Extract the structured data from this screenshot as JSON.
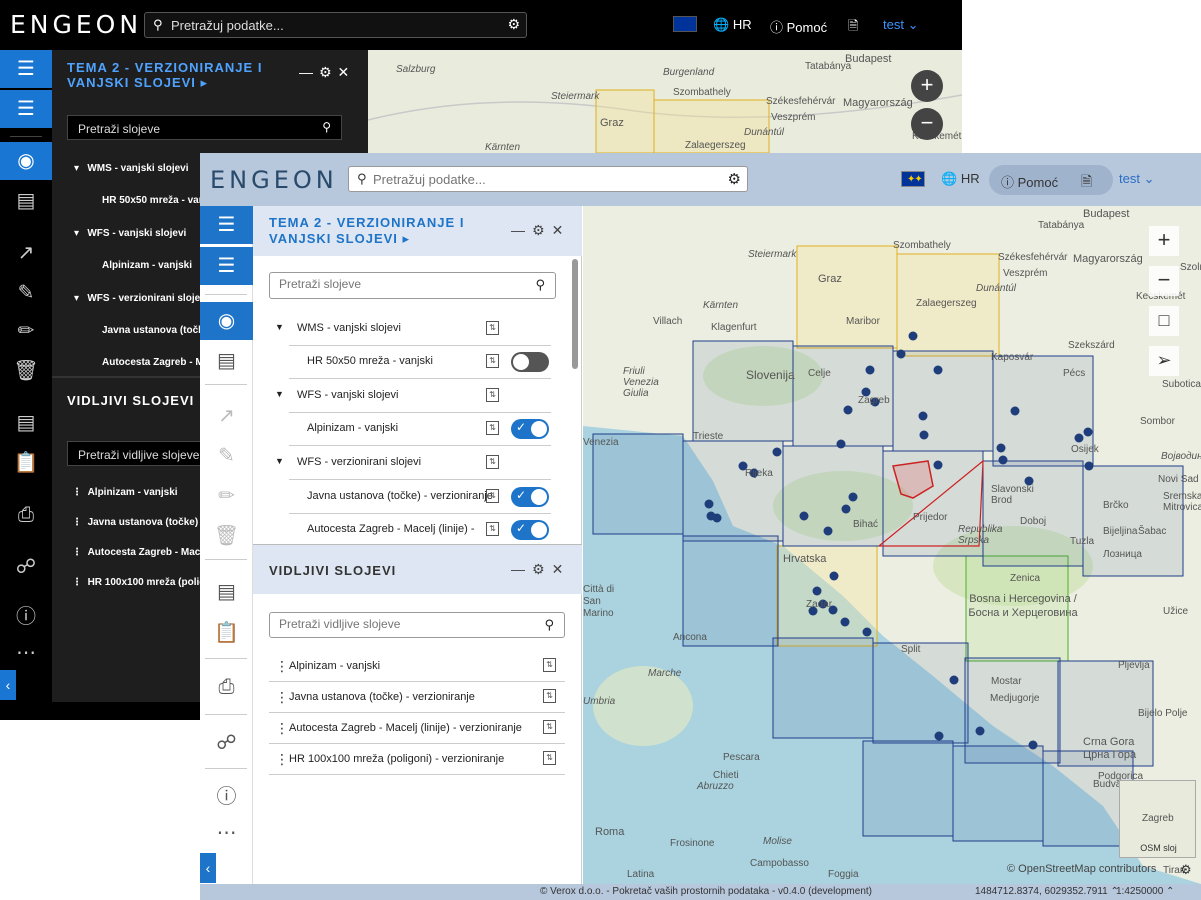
{
  "dark": {
    "logo": "ENGEON",
    "search_placeholder": "Pretražuj podatke...",
    "lang": "HR",
    "help": "Pomoć",
    "user": "test",
    "panel_title": "TEMA 2 - VERZIONIRANJE I VANJSKI SLOJEVI",
    "layer_search_placeholder": "Pretraži slojeve",
    "tree": [
      {
        "label": "WMS - vanjski slojevi",
        "group": true
      },
      {
        "label": "HR 50x50 mreža - vanjski",
        "group": false
      },
      {
        "label": "WFS - vanjski slojevi",
        "group": true
      },
      {
        "label": "Alpinizam - vanjski",
        "group": false
      },
      {
        "label": "WFS - verzionirani slojevi",
        "group": true
      },
      {
        "label": "Javna ustanova (točke)",
        "group": false
      },
      {
        "label": "Autocesta Zagreb - Mac",
        "group": false
      }
    ],
    "visible_title": "VIDLJIVI SLOJEVI",
    "visible_search_placeholder": "Pretraži vidljive slojeve",
    "visible": [
      "Alpinizam - vanjski",
      "Javna ustanova (točke) - ve",
      "Autocesta Zagreb - Macelj (",
      "HR 100x100 mreža (poligoni"
    ],
    "map_labels": [
      "Salzburg",
      "Burgenland",
      "Budapest",
      "Tatabánya",
      "Szombathely",
      "Székesfehérvár",
      "Magyarország",
      "Graz",
      "Veszprém",
      "Steiermark",
      "Dunántúl",
      "Zalaegerszeg",
      "Kecskemét",
      "Kärnten"
    ]
  },
  "front": {
    "logo": "ENGEON",
    "search_placeholder": "Pretražuj podatke...",
    "lang": "HR",
    "help": "Pomoć",
    "user": "test",
    "panel_title": "TEMA 2 - VERZIONIRANJE I VANJSKI SLOJEVI",
    "layer_search_placeholder": "Pretraži slojeve",
    "tree": [
      {
        "label": "WMS - vanjski slojevi",
        "group": true
      },
      {
        "label": "HR 50x50 mreža - vanjski",
        "group": false,
        "toggle": "off"
      },
      {
        "label": "WFS - vanjski slojevi",
        "group": true
      },
      {
        "label": "Alpinizam - vanjski",
        "group": false,
        "toggle": "on"
      },
      {
        "label": "WFS - verzionirani slojevi",
        "group": true
      },
      {
        "label": "Javna ustanova (točke) - verzioniranje",
        "group": false,
        "toggle": "on"
      },
      {
        "label": "Autocesta Zagreb - Macelj (linije) -",
        "group": false,
        "toggle": "on"
      }
    ],
    "visible_title": "VIDLJIVI SLOJEVI",
    "visible_search_placeholder": "Pretraži vidljive slojeve",
    "visible": [
      "Alpinizam - vanjski",
      "Javna ustanova (točke) - verzioniranje",
      "Autocesta Zagreb - Macelj (linije) - verzioniranje",
      "HR 100x100 mreža (poligoni) - verzioniranje"
    ],
    "map_labels": [
      "Steiermark",
      "Szombathely",
      "Budapest",
      "Tatabánya",
      "Székesfehérvár",
      "Magyarország",
      "Szoln",
      "Graz",
      "Veszprém",
      "Kecskemét",
      "Dunántúl",
      "Zalaegerszeg",
      "Kärnten",
      "Villach",
      "Klagenfurt",
      "Maribor",
      "Kaposvár",
      "Szekszárd",
      "Pécs",
      "Subotica",
      "Slovenija",
      "Celje",
      "Friuli Venezia Giulia",
      "Zagreb",
      "Sombor",
      "Trieste",
      "Osijek",
      "Venezia",
      "Rijeka",
      "Војводина",
      "Novi Sad",
      "Slavonski Brod",
      "Sremska Mitrovica",
      "Prijedor",
      "Brčko",
      "Doboj",
      "Bijeljina",
      "Bihać",
      "Tuzla",
      "Šabac",
      "Лозница",
      "Republika Srpska",
      "Hrvatska",
      "Zenica",
      "Città di San Marino",
      "Zadar",
      "Bosna i Hercegovina / Босна и Херцеговина",
      "Ancona",
      "Užice",
      "Marche",
      "Split",
      "Mostar",
      "Medjugorje",
      "Pljevlja",
      "Umbria",
      "Bijelo Polje",
      "Pescara",
      "Chieti",
      "Crna Gora Црна Гора",
      "Abruzzo",
      "Budva",
      "Podgorica",
      "Roma",
      "Molise",
      "Frosinone",
      "Campobasso",
      "Latina",
      "Foggia",
      "Tiran"
    ],
    "osm_label": "OSM sloj",
    "osm_place": "Zagreb",
    "attribution": "© OpenStreetMap contributors",
    "status": "© Verox d.o.o. - Pokretač vaših prostornih podataka - v0.4.0 (development)",
    "coords": "1484712.8374, 6029352.7911",
    "scale": "1:4250000"
  },
  "colors": {
    "accent": "#1e74c8",
    "topbar": "#b7c7dc",
    "panel_head": "#dde6f2",
    "grid_blue": "#1f3d8a",
    "grid_yellow": "#e0b020",
    "grid_green": "#4caf2a",
    "polygon_red": "#cc2222",
    "point": "#1f3d7a"
  },
  "icons": [
    "layers-icon",
    "list-icon",
    "fingerprint-icon",
    "ruler-icon",
    "pointer-icon",
    "edit-icon",
    "pencil-icon",
    "trash-icon",
    "legend-icon",
    "clipboard-icon",
    "print-icon",
    "network-icon",
    "help-icon",
    "more-icon"
  ]
}
